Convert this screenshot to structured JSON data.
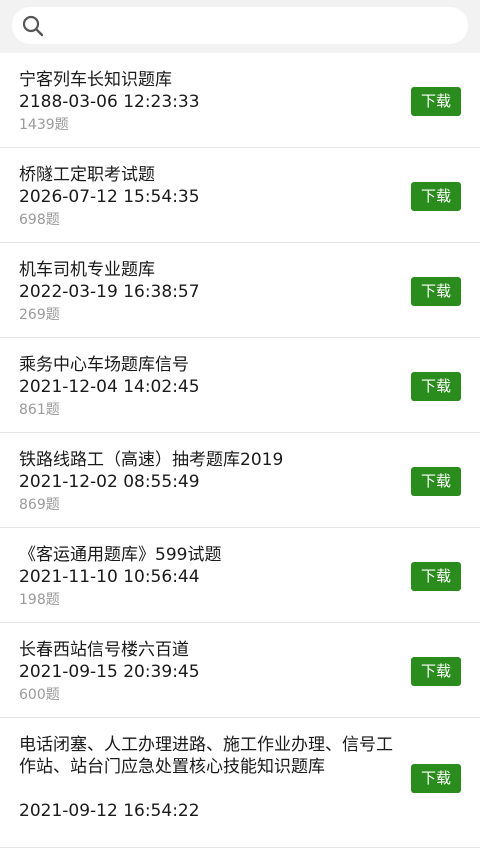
{
  "search": {
    "placeholder": ""
  },
  "download_label": "下载",
  "items": [
    {
      "title": "宁客列车长知识题库",
      "date": "2188-03-06 12:23:33",
      "count": "1439题"
    },
    {
      "title": "桥隧工定职考试题",
      "date": "2026-07-12 15:54:35",
      "count": "698题"
    },
    {
      "title": "机车司机专业题库",
      "date": "2022-03-19 16:38:57",
      "count": "269题"
    },
    {
      "title": "乘务中心车场题库信号",
      "date": "2021-12-04 14:02:45",
      "count": "861题"
    },
    {
      "title": "铁路线路工（高速）抽考题库2019",
      "date": "2021-12-02 08:55:49",
      "count": "869题"
    },
    {
      "title": "《客运通用题库》599试题",
      "date": "2021-11-10 10:56:44",
      "count": "198题"
    },
    {
      "title": "长春西站信号楼六百道",
      "date": "2021-09-15 20:39:45",
      "count": "600题"
    },
    {
      "title": "电话闭塞、人工办理进路、施工作业办理、信号工作站、站台门应急处置核心技能知识题库",
      "date": "2021-09-12 16:54:22",
      "count": ""
    }
  ],
  "colors": {
    "accent": "#2a8c1d",
    "background": "#f2f2f2",
    "muted_text": "#9a9a9a"
  }
}
